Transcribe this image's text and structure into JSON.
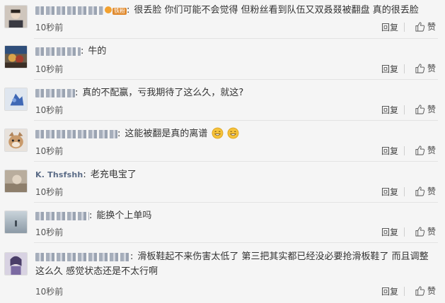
{
  "comments": [
    {
      "user_badge": "铁粉",
      "text": "很丢脸 你们可能不会觉得 但粉丝看到队伍又双叒叕被翻盘 真的很丢脸",
      "time": "10秒前",
      "reply": "回复",
      "like": "赞"
    },
    {
      "text": "牛的",
      "time": "10秒前",
      "reply": "回复",
      "like": "赞"
    },
    {
      "text": "真的不配赢，亏我期待了这么久，就这?",
      "time": "10秒前",
      "reply": "回复",
      "like": "赞"
    },
    {
      "text": "这能被翻是真的离谱",
      "emoji": "grin-emoji",
      "time": "10秒前",
      "reply": "回复",
      "like": "赞"
    },
    {
      "username": "K. Thsfshh",
      "text": "老充电宝了",
      "time": "10秒前",
      "reply": "回复",
      "like": "赞"
    },
    {
      "text": "能换个上单吗",
      "time": "10秒前",
      "reply": "回复",
      "like": "赞"
    },
    {
      "text": "滑板鞋起不来伤害太低了 第三把其实都已经没必要抢滑板鞋了 而且调整这么久 感觉状态还是不太行啊",
      "time": "10秒前",
      "reply": "回复",
      "like": "赞"
    }
  ],
  "colors": {
    "background": "#f5f5f5",
    "divider": "#e3e3e3",
    "text": "#333333",
    "badge": "#e08a2e"
  }
}
